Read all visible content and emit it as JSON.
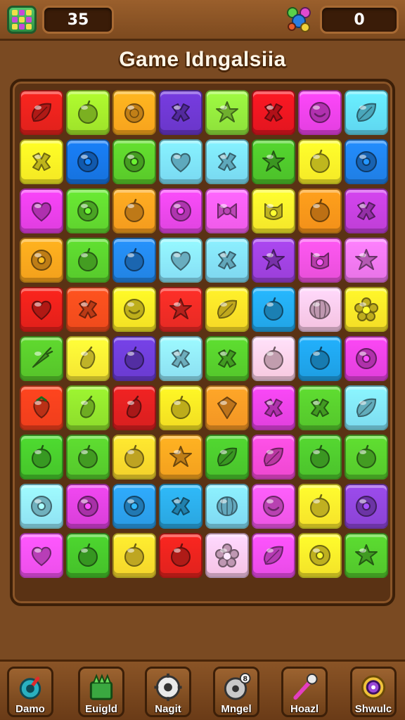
{
  "header": {
    "score": "35",
    "coins": "0",
    "menu_icon": "level-grid-icon",
    "gift_icon": "gift-icon"
  },
  "title": "Game Idngalsiia",
  "board": {
    "rows": [
      [
        [
          "#e0211c",
          "leaf"
        ],
        [
          "#9ee22a",
          "apple"
        ],
        [
          "#f7a31d",
          "orange"
        ],
        [
          "#6a36c9",
          "x"
        ],
        [
          "#8ee03b",
          "star"
        ],
        [
          "#e2151f",
          "x"
        ],
        [
          "#e33fe0",
          "smiley"
        ],
        [
          "#5fd6f0",
          "leaf"
        ]
      ],
      [
        [
          "#f4e823",
          "x"
        ],
        [
          "#1672de",
          "donut"
        ],
        [
          "#59c92a",
          "donut"
        ],
        [
          "#79d9f2",
          "heart"
        ],
        [
          "#78d8f0",
          "x"
        ],
        [
          "#4cc02a",
          "star"
        ],
        [
          "#f5ea27",
          "apple"
        ],
        [
          "#1f7ee3",
          "donut"
        ]
      ],
      [
        [
          "#df3ddf",
          "heart"
        ],
        [
          "#5fd22e",
          "donut"
        ],
        [
          "#f49b1e",
          "apple"
        ],
        [
          "#e044e0",
          "donut"
        ],
        [
          "#ef5be8",
          "bow"
        ],
        [
          "#f4e62a",
          "cat"
        ],
        [
          "#f29019",
          "plum"
        ],
        [
          "#be3ed6",
          "x"
        ]
      ],
      [
        [
          "#f3a01c",
          "donut"
        ],
        [
          "#57c92c",
          "apple"
        ],
        [
          "#2283e2",
          "plum"
        ],
        [
          "#86def5",
          "heart"
        ],
        [
          "#7ed6ef",
          "x"
        ],
        [
          "#9a3fd8",
          "star"
        ],
        [
          "#e84fd9",
          "cat"
        ],
        [
          "#e773e6",
          "star"
        ]
      ],
      [
        [
          "#e1201a",
          "heart"
        ],
        [
          "#ef4a1c",
          "x"
        ],
        [
          "#f3e024",
          "smiley"
        ],
        [
          "#e62a24",
          "star"
        ],
        [
          "#f6d826",
          "leaf"
        ],
        [
          "#22a4e6",
          "plum"
        ],
        [
          "#f4c2e0",
          "melon"
        ],
        [
          "#f4dd26",
          "flower"
        ]
      ],
      [
        [
          "#56c32a",
          "carrot"
        ],
        [
          "#f5e533",
          "pepper"
        ],
        [
          "#6a3bd0",
          "plum"
        ],
        [
          "#8cdff2",
          "x"
        ],
        [
          "#54c72b",
          "x"
        ],
        [
          "#f7c9df",
          "apple"
        ],
        [
          "#1e9ee2",
          "plum"
        ],
        [
          "#e13fdb",
          "donut"
        ]
      ],
      [
        [
          "#ef3e1c",
          "strawberry"
        ],
        [
          "#8ddc2c",
          "pepper"
        ],
        [
          "#d81f1f",
          "pepper"
        ],
        [
          "#f2dd22",
          "apple"
        ],
        [
          "#f29524",
          "kite"
        ],
        [
          "#e040dd",
          "x"
        ],
        [
          "#55c62c",
          "x"
        ],
        [
          "#7ddcf0",
          "candy"
        ]
      ],
      [
        [
          "#46c42b",
          "plum"
        ],
        [
          "#55c72c",
          "apple"
        ],
        [
          "#f3d12b",
          "apple"
        ],
        [
          "#f3a01e",
          "star"
        ],
        [
          "#49c22c",
          "leaf"
        ],
        [
          "#ee48d0",
          "leaf"
        ],
        [
          "#4cc22c",
          "plum"
        ],
        [
          "#56c82c",
          "plum"
        ]
      ],
      [
        [
          "#8fe1f2",
          "donut"
        ],
        [
          "#d83fd8",
          "donut"
        ],
        [
          "#2a9ae4",
          "donut"
        ],
        [
          "#2aa6df",
          "x"
        ],
        [
          "#7fd8f2",
          "melon"
        ],
        [
          "#ec55e3",
          "smiley"
        ],
        [
          "#f6e22a",
          "apple"
        ],
        [
          "#8b43d4",
          "donut"
        ]
      ],
      [
        [
          "#ec4fea",
          "heart"
        ],
        [
          "#45c02a",
          "apple"
        ],
        [
          "#f4d52b",
          "plum"
        ],
        [
          "#e0221d",
          "plum"
        ],
        [
          "#f5c2e4",
          "flower"
        ],
        [
          "#e84be6",
          "leaf"
        ],
        [
          "#f3e228",
          "donut"
        ],
        [
          "#52c52c",
          "star"
        ]
      ]
    ]
  },
  "toolbar": [
    {
      "label": "Damo",
      "icon": "hook-icon"
    },
    {
      "label": "Euigld",
      "icon": "grass-icon"
    },
    {
      "label": "Nagit",
      "icon": "gear-icon"
    },
    {
      "label": "Mngel",
      "icon": "compass-icon"
    },
    {
      "label": "Hoazl",
      "icon": "wand-icon"
    },
    {
      "label": "Shwulc",
      "icon": "ring-icon"
    }
  ]
}
